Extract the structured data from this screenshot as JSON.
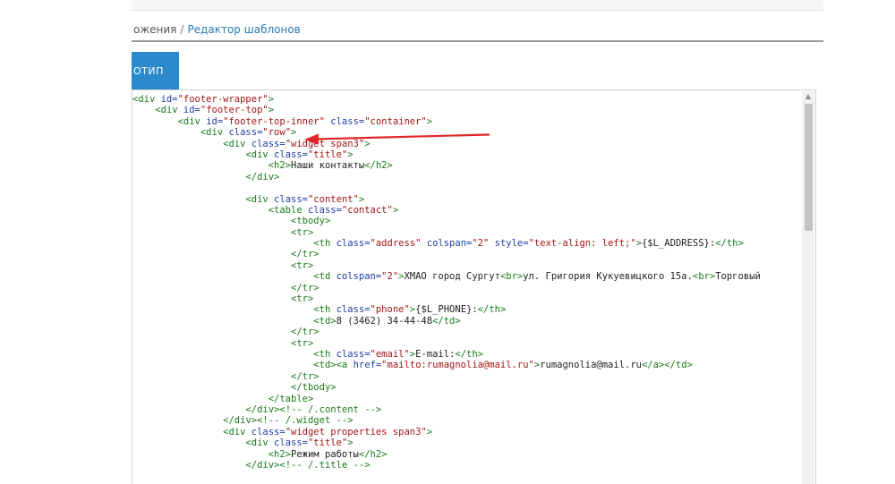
{
  "breadcrumb": {
    "parent": "ожения",
    "separator": "/",
    "current": "Редактор шаблонов"
  },
  "tab": {
    "label": "ОТИП"
  },
  "colors": {
    "accent": "#2a8acc",
    "annotation_arrow": "#e0262a",
    "tag": "#1a7a1a",
    "attr": "#1d3fa6",
    "value": "#a31515"
  },
  "code_lines": [
    [
      [
        "tag",
        "<div "
      ],
      [
        "attr",
        "id="
      ],
      [
        "val",
        "\"footer-wrapper\""
      ],
      [
        "tag",
        ">"
      ]
    ],
    [
      [
        "sp",
        "    "
      ],
      [
        "tag",
        "<div "
      ],
      [
        "attr",
        "id="
      ],
      [
        "val",
        "\"footer-top\""
      ],
      [
        "tag",
        ">"
      ]
    ],
    [
      [
        "sp",
        "        "
      ],
      [
        "tag",
        "<div "
      ],
      [
        "attr",
        "id="
      ],
      [
        "val",
        "\"footer-top-inner\""
      ],
      [
        "txt",
        " "
      ],
      [
        "attr",
        "class="
      ],
      [
        "val",
        "\"container\""
      ],
      [
        "tag",
        ">"
      ]
    ],
    [
      [
        "sp",
        "            "
      ],
      [
        "tag",
        "<div "
      ],
      [
        "attr",
        "class="
      ],
      [
        "val",
        "\"row\""
      ],
      [
        "tag",
        ">"
      ]
    ],
    [
      [
        "sp",
        "                "
      ],
      [
        "tag",
        "<div "
      ],
      [
        "attr",
        "class="
      ],
      [
        "val",
        "\"widget span3\""
      ],
      [
        "tag",
        ">"
      ]
    ],
    [
      [
        "sp",
        "                    "
      ],
      [
        "tag",
        "<div "
      ],
      [
        "attr",
        "class="
      ],
      [
        "val",
        "\"title\""
      ],
      [
        "tag",
        ">"
      ]
    ],
    [
      [
        "sp",
        "                        "
      ],
      [
        "tag",
        "<h2>"
      ],
      [
        "txt",
        "Наши контакты"
      ],
      [
        "tag",
        "</h2>"
      ]
    ],
    [
      [
        "sp",
        "                    "
      ],
      [
        "tag",
        "</div>"
      ]
    ],
    [
      [
        "sp",
        ""
      ]
    ],
    [
      [
        "sp",
        "                    "
      ],
      [
        "tag",
        "<div "
      ],
      [
        "attr",
        "class="
      ],
      [
        "val",
        "\"content\""
      ],
      [
        "tag",
        ">"
      ]
    ],
    [
      [
        "sp",
        "                        "
      ],
      [
        "tag",
        "<table "
      ],
      [
        "attr",
        "class="
      ],
      [
        "val",
        "\"contact\""
      ],
      [
        "tag",
        ">"
      ]
    ],
    [
      [
        "sp",
        "                            "
      ],
      [
        "tag",
        "<tbody>"
      ]
    ],
    [
      [
        "sp",
        "                            "
      ],
      [
        "tag",
        "<tr>"
      ]
    ],
    [
      [
        "sp",
        "                                "
      ],
      [
        "tag",
        "<th "
      ],
      [
        "attr",
        "class="
      ],
      [
        "val",
        "\"address\""
      ],
      [
        "txt",
        " "
      ],
      [
        "attr",
        "colspan="
      ],
      [
        "val",
        "\"2\""
      ],
      [
        "txt",
        " "
      ],
      [
        "attr",
        "style="
      ],
      [
        "val",
        "\"text-align: left;\""
      ],
      [
        "tag",
        ">"
      ],
      [
        "txt",
        "{$L_ADDRESS}:"
      ],
      [
        "tag",
        "</th>"
      ]
    ],
    [
      [
        "sp",
        "                            "
      ],
      [
        "tag",
        "</tr>"
      ]
    ],
    [
      [
        "sp",
        "                            "
      ],
      [
        "tag",
        "<tr>"
      ]
    ],
    [
      [
        "sp",
        "                                "
      ],
      [
        "tag",
        "<td "
      ],
      [
        "attr",
        "colspan="
      ],
      [
        "val",
        "\"2\""
      ],
      [
        "tag",
        ">"
      ],
      [
        "txt",
        "ХМАО город Сургут"
      ],
      [
        "tag",
        "<br>"
      ],
      [
        "txt",
        "ул. Григория Кукуевицкого 15а."
      ],
      [
        "tag",
        "<br>"
      ],
      [
        "txt",
        "Торговый"
      ]
    ],
    [
      [
        "sp",
        "                            "
      ],
      [
        "tag",
        "</tr>"
      ]
    ],
    [
      [
        "sp",
        "                            "
      ],
      [
        "tag",
        "<tr>"
      ]
    ],
    [
      [
        "sp",
        "                                "
      ],
      [
        "tag",
        "<th "
      ],
      [
        "attr",
        "class="
      ],
      [
        "val",
        "\"phone\""
      ],
      [
        "tag",
        ">"
      ],
      [
        "txt",
        "{$L_PHONE}:"
      ],
      [
        "tag",
        "</th>"
      ]
    ],
    [
      [
        "sp",
        "                                "
      ],
      [
        "tag",
        "<td>"
      ],
      [
        "txt",
        "8 (3462) 34-44-48"
      ],
      [
        "tag",
        "</td>"
      ]
    ],
    [
      [
        "sp",
        "                            "
      ],
      [
        "tag",
        "</tr>"
      ]
    ],
    [
      [
        "sp",
        "                            "
      ],
      [
        "tag",
        "<tr>"
      ]
    ],
    [
      [
        "sp",
        "                                "
      ],
      [
        "tag",
        "<th "
      ],
      [
        "attr",
        "class="
      ],
      [
        "val",
        "\"email\""
      ],
      [
        "tag",
        ">"
      ],
      [
        "txt",
        "E-mail:"
      ],
      [
        "tag",
        "</th>"
      ]
    ],
    [
      [
        "sp",
        "                                "
      ],
      [
        "tag",
        "<td><a "
      ],
      [
        "attr",
        "href="
      ],
      [
        "val",
        "\"mailto:rumagnolia@mail.ru\""
      ],
      [
        "tag",
        ">"
      ],
      [
        "txt",
        "rumagnolia@mail.ru"
      ],
      [
        "tag",
        "</a></td>"
      ]
    ],
    [
      [
        "sp",
        "                            "
      ],
      [
        "tag",
        "</tr>"
      ]
    ],
    [
      [
        "sp",
        "                            "
      ],
      [
        "tag",
        "</tbody>"
      ]
    ],
    [
      [
        "sp",
        "                        "
      ],
      [
        "tag",
        "</table>"
      ]
    ],
    [
      [
        "sp",
        "                    "
      ],
      [
        "tag",
        "</div>"
      ],
      [
        "cmt",
        "<!-- /.content -->"
      ]
    ],
    [
      [
        "sp",
        "                "
      ],
      [
        "tag",
        "</div>"
      ],
      [
        "cmt",
        "<!-- /.widget -->"
      ]
    ],
    [
      [
        "sp",
        "                "
      ],
      [
        "tag",
        "<div "
      ],
      [
        "attr",
        "class="
      ],
      [
        "val",
        "\"widget properties span3\""
      ],
      [
        "tag",
        ">"
      ]
    ],
    [
      [
        "sp",
        "                    "
      ],
      [
        "tag",
        "<div "
      ],
      [
        "attr",
        "class="
      ],
      [
        "val",
        "\"title\""
      ],
      [
        "tag",
        ">"
      ]
    ],
    [
      [
        "sp",
        "                        "
      ],
      [
        "tag",
        "<h2>"
      ],
      [
        "txt",
        "Режим работы"
      ],
      [
        "tag",
        "</h2>"
      ]
    ],
    [
      [
        "sp",
        "                    "
      ],
      [
        "tag",
        "</div>"
      ],
      [
        "cmt",
        "<!-- /.title -->"
      ]
    ]
  ]
}
